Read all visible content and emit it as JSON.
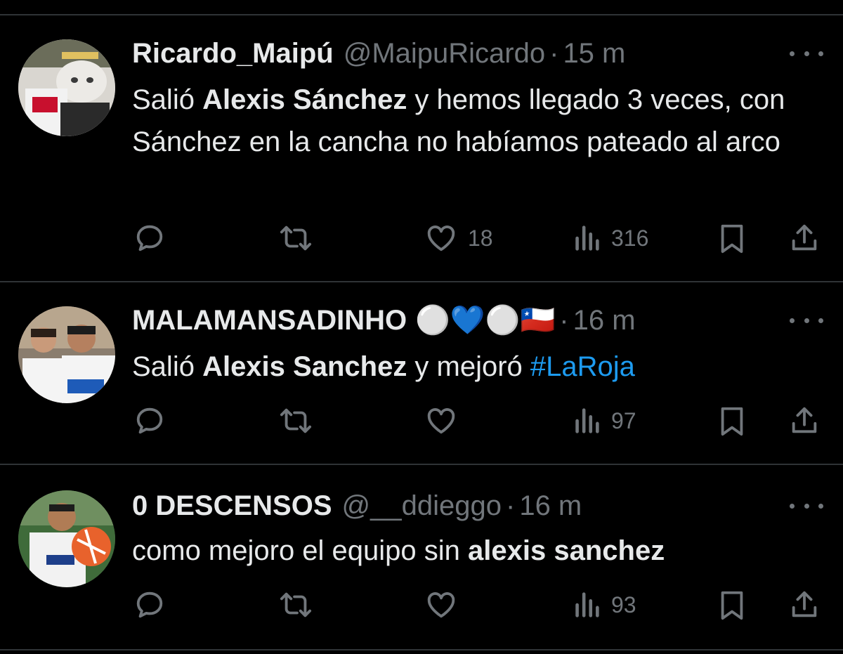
{
  "tweets": [
    {
      "name": "Ricardo_Maipú",
      "handle": "@MaipuRicardo",
      "sep": "·",
      "time": "15 m",
      "text_parts": [
        "Salió ",
        "Alexis Sánchez",
        " y hemos llegado 3 veces, con Sánchez en la cancha no habíamos pateado al arco"
      ],
      "replies": "",
      "retweets": "",
      "likes": "18",
      "views": "316"
    },
    {
      "name": "MALAMANSADINHO",
      "name_emoji": "⚪💙⚪🇨🇱",
      "sep": "·",
      "time": "16 m",
      "text_parts": [
        "Salió ",
        "Alexis Sanchez",
        " y mejoró ",
        "#LaRoja"
      ],
      "replies": "",
      "retweets": "",
      "likes": "",
      "views": "97"
    },
    {
      "name": "0 DESCENSOS",
      "handle": "@__ddieggo",
      "sep": "·",
      "time": "16 m",
      "text_parts": [
        "como mejoro el equipo sin ",
        "alexis sanchez"
      ],
      "replies": "",
      "retweets": "",
      "likes": "",
      "views": "93"
    }
  ],
  "icons": {
    "reply": "reply-icon",
    "retweet": "retweet-icon",
    "like": "heart-icon",
    "views": "views-icon",
    "bookmark": "bookmark-icon",
    "share": "share-icon",
    "more": "more-icon"
  },
  "colors": {
    "background": "#000000",
    "text": "#e7e9ea",
    "secondary": "#71767b",
    "link": "#1d9bf0",
    "divider": "#2f3336"
  }
}
